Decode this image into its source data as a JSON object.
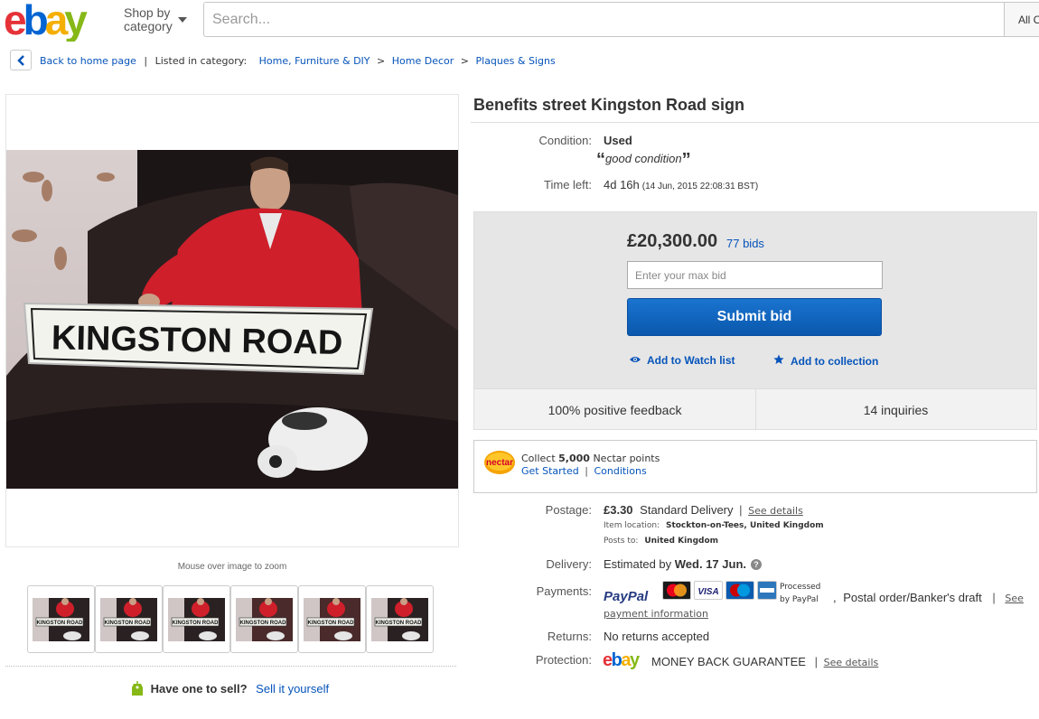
{
  "header": {
    "logo_text": "ebay",
    "shop_by_line1": "Shop by",
    "shop_by_line2": "category",
    "search_placeholder": "Search...",
    "category_select": "All C"
  },
  "breadcrumb": {
    "back_label": "Back to home page",
    "listed_label": "Listed in category:",
    "items": [
      "Home, Furniture & DIY",
      "Home Decor",
      "Plaques & Signs"
    ],
    "separator": ">"
  },
  "gallery": {
    "zoom_hint": "Mouse over image to zoom",
    "sign_text": "KINGSTON ROAD",
    "thumbnail_count": 6
  },
  "sell": {
    "question": "Have one to sell?",
    "link": "Sell it yourself"
  },
  "item": {
    "title": "Benefits street Kingston Road sign",
    "condition_label": "Condition:",
    "condition_value": "Used",
    "condition_note": "good condition",
    "time_label": "Time left:",
    "time_value": "4d 16h",
    "time_detail": "(14 Jun, 2015   22:08:31 BST)"
  },
  "bid": {
    "price": "£20,300.00",
    "bids": "77 bids",
    "max_bid_placeholder": "Enter your max bid",
    "submit_label": "Submit bid",
    "watch_label": "Add to Watch list",
    "collection_label": "Add to collection",
    "feedback": "100% positive feedback",
    "inquiries": "14 inquiries"
  },
  "nectar": {
    "logo": "nectar",
    "collect_prefix": "Collect ",
    "points": "5,000",
    "collect_suffix": " Nectar points",
    "get_started": "Get Started",
    "conditions": "Conditions"
  },
  "postage": {
    "label": "Postage:",
    "price": "£3.30",
    "method": "Standard Delivery",
    "see_details": "See details",
    "location_label": "Item location:",
    "location": "Stockton-on-Tees, United Kingdom",
    "posts_to_label": "Posts to:",
    "posts_to": "United Kingdom"
  },
  "delivery": {
    "label": "Delivery:",
    "prefix": "Estimated by ",
    "date": "Wed. 17 Jun.",
    "help": "?"
  },
  "payments": {
    "label": "Payments:",
    "paypal": "PayPal",
    "cards": [
      "MasterCard",
      "VISA",
      "Maestro",
      "AmEx"
    ],
    "processed_line1": "Processed",
    "processed_line2": "by PayPal",
    "other": "Postal order/Banker's draft",
    "see_payment_1": "See",
    "see_payment_2": "payment information"
  },
  "returns": {
    "label": "Returns:",
    "value": "No returns accepted"
  },
  "protection": {
    "label": "Protection:",
    "logo": "ebay",
    "guarantee": "MONEY BACK GUARANTEE",
    "see_details": "See details"
  },
  "colors": {
    "ebay_red": "#e53238",
    "ebay_blue": "#0064d2",
    "ebay_yellow": "#f5af02",
    "ebay_green": "#86b817",
    "link_blue": "#0654ba",
    "button_blue": "#0a58ad"
  }
}
